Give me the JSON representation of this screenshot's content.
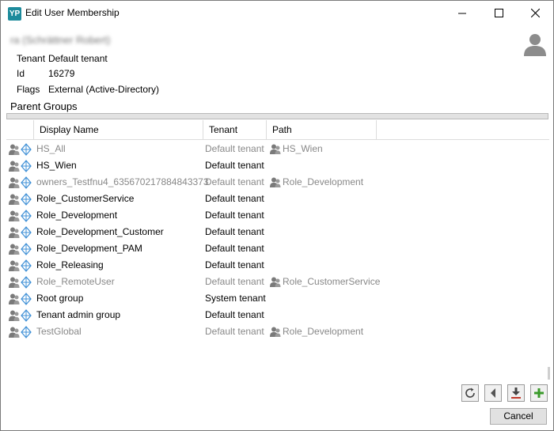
{
  "window": {
    "title": "Edit User Membership",
    "app_icon_text": "YP"
  },
  "user": {
    "name": "ra (Schrättner Robert)",
    "props": [
      {
        "label": "Tenant",
        "value": "Default tenant"
      },
      {
        "label": "Id",
        "value": "16279"
      },
      {
        "label": "Flags",
        "value": "External (Active-Directory)"
      }
    ]
  },
  "section": {
    "title": "Parent Groups"
  },
  "grid": {
    "columns": [
      "Display Name",
      "Tenant",
      "Path"
    ],
    "rows": [
      {
        "name": "HS_All",
        "tenant": "Default tenant",
        "path": "HS_Wien",
        "inherited": true
      },
      {
        "name": "HS_Wien",
        "tenant": "Default tenant",
        "path": "",
        "inherited": false
      },
      {
        "name": "owners_Testfnu4_635670217884843373",
        "tenant": "Default tenant",
        "path": "Role_Development",
        "inherited": true
      },
      {
        "name": "Role_CustomerService",
        "tenant": "Default tenant",
        "path": "",
        "inherited": false
      },
      {
        "name": "Role_Development",
        "tenant": "Default tenant",
        "path": "",
        "inherited": false
      },
      {
        "name": "Role_Development_Customer",
        "tenant": "Default tenant",
        "path": "",
        "inherited": false
      },
      {
        "name": "Role_Development_PAM",
        "tenant": "Default tenant",
        "path": "",
        "inherited": false
      },
      {
        "name": "Role_Releasing",
        "tenant": "Default tenant",
        "path": "",
        "inherited": false
      },
      {
        "name": "Role_RemoteUser",
        "tenant": "Default tenant",
        "path": "Role_CustomerService",
        "inherited": true
      },
      {
        "name": "Root group",
        "tenant": "System tenant",
        "path": "",
        "inherited": false
      },
      {
        "name": "Tenant admin group",
        "tenant": "Default tenant",
        "path": "",
        "inherited": false
      },
      {
        "name": "TestGlobal",
        "tenant": "Default tenant",
        "path": "Role_Development",
        "inherited": true
      }
    ]
  },
  "toolbar": {
    "buttons": [
      "refresh-icon",
      "back-icon",
      "download-icon",
      "add-icon"
    ]
  },
  "footer": {
    "cancel_label": "Cancel"
  },
  "colors": {
    "app_icon": "#1d8b9c",
    "inherited_text": "#888888",
    "add_green": "#3a9a2a",
    "download_red": "#c0392b"
  }
}
